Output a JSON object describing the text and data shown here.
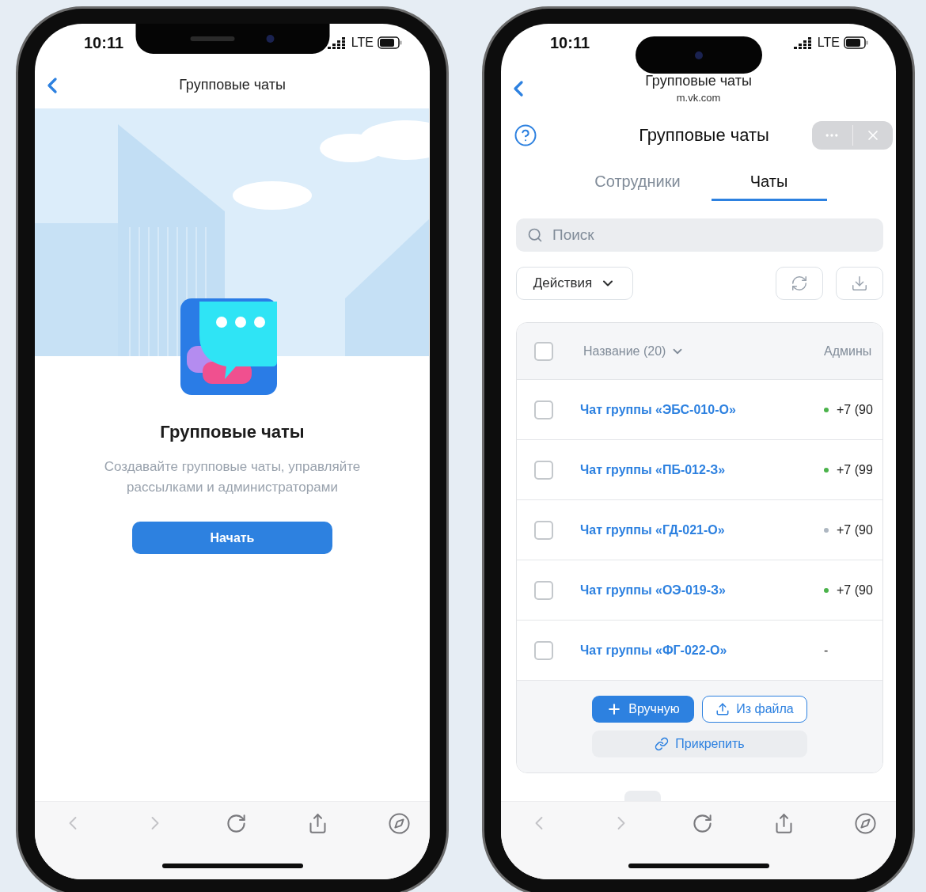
{
  "phones": [
    {
      "kind": "onboarding",
      "status_bar": {
        "time": "10:11",
        "network": "LTE"
      },
      "nav": {
        "title": "Групповые чаты"
      },
      "hero": {
        "title": "Групповые чаты",
        "description": "Создавайте групповые чаты, управляйте рассылками и администраторами",
        "button": "Начать"
      }
    },
    {
      "kind": "table",
      "status_bar": {
        "time": "10:11",
        "network": "LTE"
      },
      "nav": {
        "title": "Групповые чаты",
        "subtitle": "m.vk.com"
      },
      "header": {
        "title": "Групповые чаты"
      },
      "tabs": [
        {
          "label": "Сотрудники",
          "selected": false
        },
        {
          "label": "Чаты",
          "selected": true
        }
      ],
      "search": {
        "placeholder": "Поиск"
      },
      "actions_button": "Действия",
      "table": {
        "columns": [
          "Название (20)",
          "Админы"
        ],
        "header_checked": false,
        "rows": [
          {
            "name": "Чат группы «ЭБС-010-О»",
            "checked": false,
            "admin": "+7 (90",
            "color": "#4bb34b"
          },
          {
            "name": "Чат группы «ПБ-012-З»",
            "checked": false,
            "admin": "+7 (99",
            "color": "#4bb34b"
          },
          {
            "name": "Чат группы «ГД-021-О»",
            "checked": false,
            "admin": "+7 (90",
            "color": "#aeb7c2"
          },
          {
            "name": "Чат группы «ОЭ-019-З»",
            "checked": false,
            "admin": "+7 (90",
            "color": "#4bb34b"
          },
          {
            "name": "Чат группы «ФГ-022-О»",
            "checked": false,
            "admin": "-"
          }
        ]
      },
      "footer_buttons": [
        {
          "kind": "primary",
          "label": "Вручную"
        },
        {
          "kind": "outline",
          "label": "Из файла"
        },
        {
          "kind": "secondary",
          "label": "Прикрепить"
        }
      ]
    }
  ]
}
